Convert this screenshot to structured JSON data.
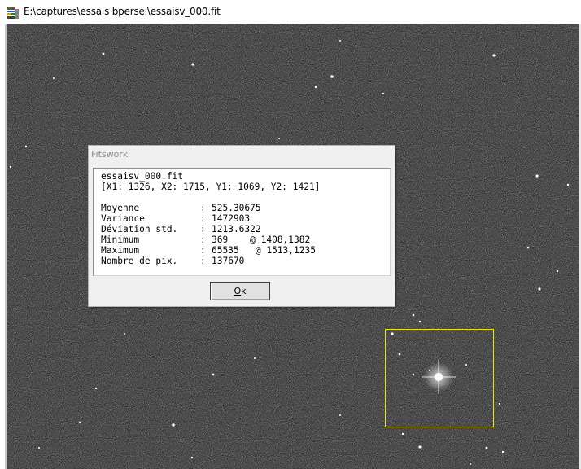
{
  "window": {
    "title": "E:\\captures\\essais bpersei\\essaisv_000.fit"
  },
  "dialog": {
    "title": "Fitswork",
    "filename": "essaisv_000.fit",
    "region": "[X1: 1326, X2: 1715, Y1: 1069, Y2: 1421]",
    "stats": [
      {
        "label": "Moyenne",
        "value": "525.30675"
      },
      {
        "label": "Variance",
        "value": "1472903"
      },
      {
        "label": "Déviation std.",
        "value": "1213.6322"
      },
      {
        "label": "Minimum",
        "value": "369    @ 1408,1382"
      },
      {
        "label": "Maximum",
        "value": "65535   @ 1513,1235"
      },
      {
        "label": "Nombre de pix.",
        "value": "137670"
      }
    ],
    "ok_mnemonic": "O",
    "ok_rest": "k"
  },
  "colors": {
    "selection": "#e6e600",
    "sky_background": "#3a3a3a"
  }
}
